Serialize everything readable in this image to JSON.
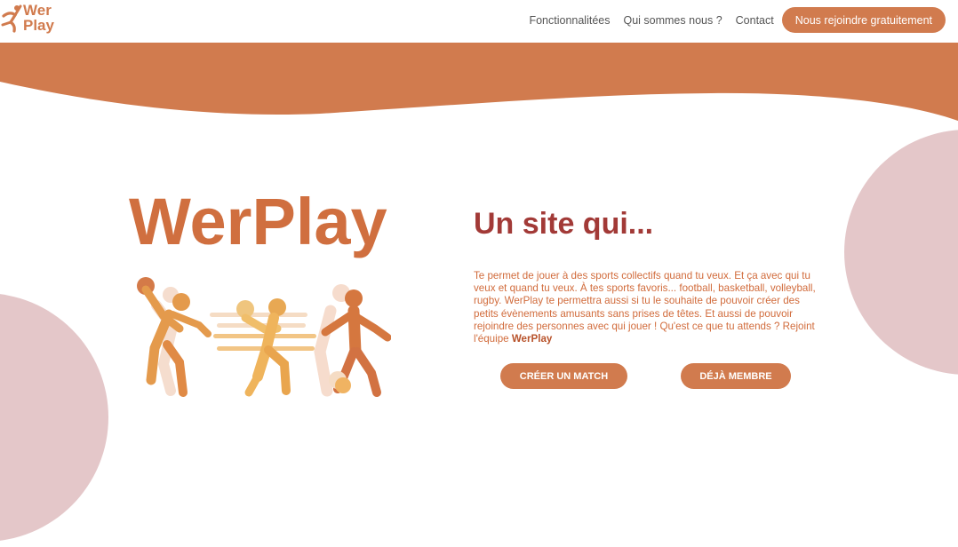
{
  "header": {
    "logo": {
      "line1": "Wer",
      "line2": "Play",
      "icon": "runner-logo-icon"
    },
    "nav": [
      {
        "label": "Fonctionnalitées"
      },
      {
        "label": "Qui sommes nous ?"
      },
      {
        "label": "Contact"
      }
    ],
    "cta_label": "Nous rejoindre gratuitement"
  },
  "hero": {
    "title": "WerPlay",
    "illustration_icon": "team-sports-players-icon"
  },
  "intro": {
    "heading": "Un site qui...",
    "body": "Te permet de jouer à des sports collectifs quand tu veux. Et ça avec qui tu veux et quand tu veux. À tes sports favoris... football, basketball, volleyball, rugby. WerPlay te permettra aussi si tu le souhaite de pouvoir créer des petits évènements amusants sans prises de têtes. Et aussi de pouvoir rejoindre des personnes avec qui jouer ! Qu'est ce que tu attends ? Rejoint l'équipe ",
    "body_strong": "WerPlay"
  },
  "buttons": {
    "create_match": "CRÉER UN MATCH",
    "already_member": "DÉJÀ MEMBRE"
  },
  "colors": {
    "brand": "#d17b4e",
    "heading": "#a23a37",
    "blob": "#e4c7c9",
    "text": "#d16b3b"
  }
}
